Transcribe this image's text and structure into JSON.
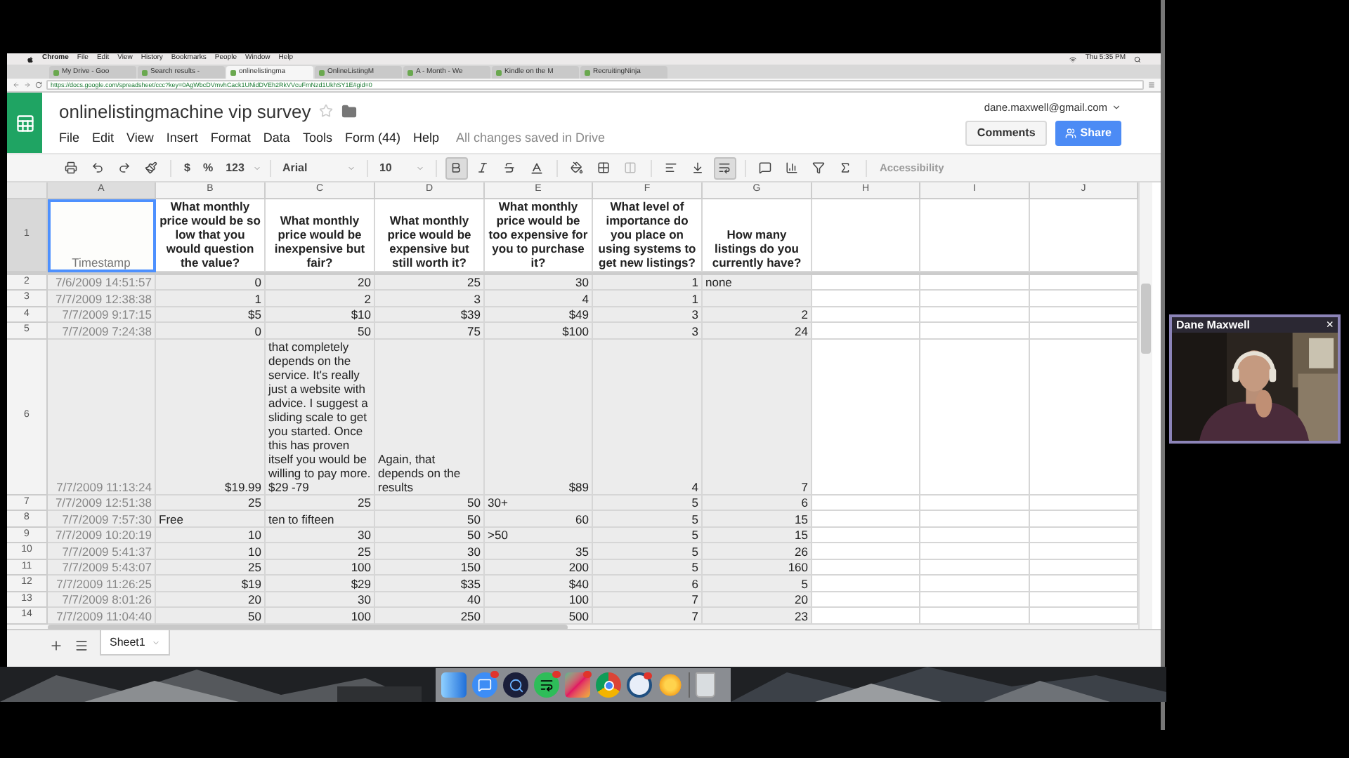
{
  "menu_bar": {
    "items": [
      "Chrome",
      "File",
      "Edit",
      "View",
      "History",
      "Bookmarks",
      "People",
      "Window",
      "Help"
    ],
    "clock": "Thu 5:35 PM"
  },
  "browser": {
    "tabs": [
      {
        "title": "My Drive - Goo",
        "selected": false
      },
      {
        "title": "Search results -",
        "selected": false
      },
      {
        "title": "onlinelistingma",
        "selected": true
      },
      {
        "title": "OnlineListingM",
        "selected": false
      },
      {
        "title": "A - Month - We",
        "selected": false
      },
      {
        "title": "Kindle on the M",
        "selected": false
      },
      {
        "title": "RecruitingNinja",
        "selected": false
      }
    ],
    "url": "https://docs.google.com/spreadsheet/ccc?key=0AgWbcDVmvhCack1UNidDVEh2RkVVcuFmNzd1UkhSY1E#gid=0"
  },
  "document": {
    "title": "onlinelistingmachine vip survey",
    "menus": [
      "File",
      "Edit",
      "View",
      "Insert",
      "Format",
      "Data",
      "Tools",
      "Form (44)",
      "Help"
    ],
    "save_status": "All changes saved in Drive",
    "account": "dane.maxwell@gmail.com",
    "comments_button": "Comments",
    "share_button": "Share"
  },
  "toolbar": {
    "number_formats": [
      "$",
      "%",
      "123"
    ],
    "font": "Arial",
    "font_size": "10",
    "style_toggles": [
      {
        "on": true
      },
      {
        "on": false
      },
      {
        "on": false
      }
    ],
    "wrap": {
      "on": true
    },
    "accessibility": {
      "label": "Accessibility",
      "disabled": true
    }
  },
  "sheet": {
    "columns": [
      "A",
      "B",
      "C",
      "D",
      "E",
      "F",
      "G",
      "H",
      "I",
      "J"
    ],
    "rows": [
      {
        "number": "1",
        "cells": [
          {
            "text": "Timestamp",
            "kind": "label",
            "selected": true
          },
          {
            "text": "What monthly price would be so low that you would question the value?",
            "kind": "header",
            "selected": false
          },
          {
            "text": "What monthly price would be inexpensive but fair?",
            "kind": "header",
            "selected": false
          },
          {
            "text": "What monthly price would be expensive but still worth it?",
            "kind": "header",
            "selected": false
          },
          {
            "text": "What monthly price would be too expensive for you to purchase it?",
            "kind": "header",
            "selected": false
          },
          {
            "text": "What level of importance do you place on using systems to get new listings?",
            "kind": "header",
            "selected": false
          },
          {
            "text": "How many listings do you currently have?",
            "kind": "header",
            "selected": false
          },
          {
            "kind": "empty",
            "selected": false
          },
          {
            "kind": "empty",
            "selected": false
          },
          {
            "kind": "empty",
            "selected": false
          }
        ]
      },
      {
        "number": "2",
        "cells": [
          {
            "text": "7/6/2009 14:51:57",
            "kind": "timestamp",
            "selected": false
          },
          {
            "text": "0",
            "kind": "number",
            "selected": false
          },
          {
            "text": "20",
            "kind": "number",
            "selected": false
          },
          {
            "text": "25",
            "kind": "number",
            "selected": false
          },
          {
            "text": "30",
            "kind": "number",
            "selected": false
          },
          {
            "text": "1",
            "kind": "number",
            "selected": false
          },
          {
            "text": "none",
            "kind": "text",
            "selected": false
          },
          {
            "kind": "empty",
            "selected": false
          },
          {
            "kind": "empty",
            "selected": false
          },
          {
            "kind": "empty",
            "selected": false
          }
        ]
      },
      {
        "number": "3",
        "cells": [
          {
            "text": "7/7/2009 12:38:38",
            "kind": "timestamp",
            "selected": false
          },
          {
            "text": "1",
            "kind": "number",
            "selected": false
          },
          {
            "text": "2",
            "kind": "number",
            "selected": false
          },
          {
            "text": "3",
            "kind": "number",
            "selected": false
          },
          {
            "text": "4",
            "kind": "number",
            "selected": false
          },
          {
            "text": "1",
            "kind": "number",
            "selected": false
          },
          {
            "kind": "blank",
            "selected": false
          },
          {
            "kind": "empty",
            "selected": false
          },
          {
            "kind": "empty",
            "selected": false
          },
          {
            "kind": "empty",
            "selected": false
          }
        ]
      },
      {
        "number": "4",
        "cells": [
          {
            "text": "7/7/2009 9:17:15",
            "kind": "timestamp",
            "selected": false
          },
          {
            "text": "$5",
            "kind": "number",
            "selected": false
          },
          {
            "text": "$10",
            "kind": "number",
            "selected": false
          },
          {
            "text": "$39",
            "kind": "number",
            "selected": false
          },
          {
            "text": "$49",
            "kind": "number",
            "selected": false
          },
          {
            "text": "3",
            "kind": "number",
            "selected": false
          },
          {
            "text": "2",
            "kind": "number",
            "selected": false
          },
          {
            "kind": "empty",
            "selected": false
          },
          {
            "kind": "empty",
            "selected": false
          },
          {
            "kind": "empty",
            "selected": false
          }
        ]
      },
      {
        "number": "5",
        "cells": [
          {
            "text": "7/7/2009 7:24:38",
            "kind": "timestamp",
            "selected": false
          },
          {
            "text": "0",
            "kind": "number",
            "selected": false
          },
          {
            "text": "50",
            "kind": "number",
            "selected": false
          },
          {
            "text": "75",
            "kind": "number",
            "selected": false
          },
          {
            "text": "$100",
            "kind": "number",
            "selected": false
          },
          {
            "text": "3",
            "kind": "number",
            "selected": false
          },
          {
            "text": "24",
            "kind": "number",
            "selected": false
          },
          {
            "kind": "empty",
            "selected": false
          },
          {
            "kind": "empty",
            "selected": false
          },
          {
            "kind": "empty",
            "selected": false
          }
        ]
      },
      {
        "number": "6",
        "cells": [
          {
            "text": "7/7/2009 11:13:24",
            "kind": "timestamp",
            "selected": false
          },
          {
            "text": "$19.99",
            "kind": "number",
            "selected": false
          },
          {
            "text": "that completely depends on the service. It's really just a website with advice. I suggest a sliding scale to get you started. Once this has proven itself you would be willing to pay more.\n$29 -79",
            "kind": "text",
            "selected": false
          },
          {
            "text": "Again, that depends on the results",
            "kind": "text",
            "selected": false
          },
          {
            "text": "$89",
            "kind": "number",
            "selected": false
          },
          {
            "text": "4",
            "kind": "number",
            "selected": false
          },
          {
            "text": "7",
            "kind": "number",
            "selected": false
          },
          {
            "kind": "empty",
            "selected": false
          },
          {
            "kind": "empty",
            "selected": false
          },
          {
            "kind": "empty",
            "selected": false
          }
        ]
      },
      {
        "number": "7",
        "cells": [
          {
            "text": "7/7/2009 12:51:38",
            "kind": "timestamp",
            "selected": false
          },
          {
            "text": "25",
            "kind": "number",
            "selected": false
          },
          {
            "text": "25",
            "kind": "number",
            "selected": false
          },
          {
            "text": "50",
            "kind": "number",
            "selected": false
          },
          {
            "text": "30+",
            "kind": "text",
            "selected": false
          },
          {
            "text": "5",
            "kind": "number",
            "selected": false
          },
          {
            "text": "6",
            "kind": "number",
            "selected": false
          },
          {
            "kind": "empty",
            "selected": false
          },
          {
            "kind": "empty",
            "selected": false
          },
          {
            "kind": "empty",
            "selected": false
          }
        ]
      },
      {
        "number": "8",
        "cells": [
          {
            "text": "7/7/2009 7:57:30",
            "kind": "timestamp",
            "selected": false
          },
          {
            "text": "Free",
            "kind": "text",
            "selected": false
          },
          {
            "text": "ten to fifteen",
            "kind": "text",
            "selected": false
          },
          {
            "text": "50",
            "kind": "number",
            "selected": false
          },
          {
            "text": "60",
            "kind": "number",
            "selected": false
          },
          {
            "text": "5",
            "kind": "number",
            "selected": false
          },
          {
            "text": "15",
            "kind": "number",
            "selected": false
          },
          {
            "kind": "empty",
            "selected": false
          },
          {
            "kind": "empty",
            "selected": false
          },
          {
            "kind": "empty",
            "selected": false
          }
        ]
      },
      {
        "number": "9",
        "cells": [
          {
            "text": "7/7/2009 10:20:19",
            "kind": "timestamp",
            "selected": false
          },
          {
            "text": "10",
            "kind": "number",
            "selected": false
          },
          {
            "text": "30",
            "kind": "number",
            "selected": false
          },
          {
            "text": "50",
            "kind": "number",
            "selected": false
          },
          {
            "text": ">50",
            "kind": "text",
            "selected": false
          },
          {
            "text": "5",
            "kind": "number",
            "selected": false
          },
          {
            "text": "15",
            "kind": "number",
            "selected": false
          },
          {
            "kind": "empty",
            "selected": false
          },
          {
            "kind": "empty",
            "selected": false
          },
          {
            "kind": "empty",
            "selected": false
          }
        ]
      },
      {
        "number": "10",
        "cells": [
          {
            "text": "7/7/2009 5:41:37",
            "kind": "timestamp",
            "selected": false
          },
          {
            "text": "10",
            "kind": "number",
            "selected": false
          },
          {
            "text": "25",
            "kind": "number",
            "selected": false
          },
          {
            "text": "30",
            "kind": "number",
            "selected": false
          },
          {
            "text": "35",
            "kind": "number",
            "selected": false
          },
          {
            "text": "5",
            "kind": "number",
            "selected": false
          },
          {
            "text": "26",
            "kind": "number",
            "selected": false
          },
          {
            "kind": "empty",
            "selected": false
          },
          {
            "kind": "empty",
            "selected": false
          },
          {
            "kind": "empty",
            "selected": false
          }
        ]
      },
      {
        "number": "11",
        "cells": [
          {
            "text": "7/7/2009 5:43:07",
            "kind": "timestamp",
            "selected": false
          },
          {
            "text": "25",
            "kind": "number",
            "selected": false
          },
          {
            "text": "100",
            "kind": "number",
            "selected": false
          },
          {
            "text": "150",
            "kind": "number",
            "selected": false
          },
          {
            "text": "200",
            "kind": "number",
            "selected": false
          },
          {
            "text": "5",
            "kind": "number",
            "selected": false
          },
          {
            "text": "160",
            "kind": "number",
            "selected": false
          },
          {
            "kind": "empty",
            "selected": false
          },
          {
            "kind": "empty",
            "selected": false
          },
          {
            "kind": "empty",
            "selected": false
          }
        ]
      },
      {
        "number": "12",
        "cells": [
          {
            "text": "7/7/2009 11:26:25",
            "kind": "timestamp",
            "selected": false
          },
          {
            "text": "$19",
            "kind": "number",
            "selected": false
          },
          {
            "text": "$29",
            "kind": "number",
            "selected": false
          },
          {
            "text": "$35",
            "kind": "number",
            "selected": false
          },
          {
            "text": "$40",
            "kind": "number",
            "selected": false
          },
          {
            "text": "6",
            "kind": "number",
            "selected": false
          },
          {
            "text": "5",
            "kind": "number",
            "selected": false
          },
          {
            "kind": "empty",
            "selected": false
          },
          {
            "kind": "empty",
            "selected": false
          },
          {
            "kind": "empty",
            "selected": false
          }
        ]
      },
      {
        "number": "13",
        "cells": [
          {
            "text": "7/7/2009 8:01:26",
            "kind": "timestamp",
            "selected": false
          },
          {
            "text": "20",
            "kind": "number",
            "selected": false
          },
          {
            "text": "30",
            "kind": "number",
            "selected": false
          },
          {
            "text": "40",
            "kind": "number",
            "selected": false
          },
          {
            "text": "100",
            "kind": "number",
            "selected": false
          },
          {
            "text": "7",
            "kind": "number",
            "selected": false
          },
          {
            "text": "20",
            "kind": "number",
            "selected": false
          },
          {
            "kind": "empty",
            "selected": false
          },
          {
            "kind": "empty",
            "selected": false
          },
          {
            "kind": "empty",
            "selected": false
          }
        ]
      },
      {
        "number": "14",
        "cells": [
          {
            "text": "7/7/2009 11:04:40",
            "kind": "timestamp",
            "selected": false
          },
          {
            "text": "50",
            "kind": "number",
            "selected": false
          },
          {
            "text": "100",
            "kind": "number",
            "selected": false
          },
          {
            "text": "250",
            "kind": "number",
            "selected": false
          },
          {
            "text": "500",
            "kind": "number",
            "selected": false
          },
          {
            "text": "7",
            "kind": "number",
            "selected": false
          },
          {
            "text": "23",
            "kind": "number",
            "selected": false
          },
          {
            "kind": "empty",
            "selected": false
          },
          {
            "kind": "empty",
            "selected": false
          },
          {
            "kind": "empty",
            "selected": false
          }
        ]
      }
    ]
  },
  "sheet_tabs": [
    {
      "label": "Sheet1",
      "selected": true
    }
  ],
  "video_call": {
    "name": "Dane Maxwell",
    "close": "×"
  }
}
